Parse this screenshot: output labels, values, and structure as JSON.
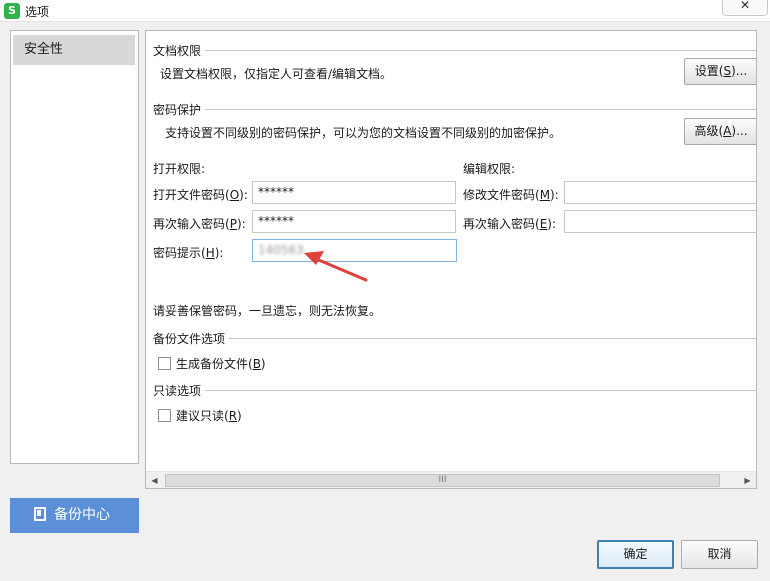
{
  "window": {
    "app_icon": "S",
    "title": "选项",
    "close": "✕"
  },
  "sidebar": {
    "items": [
      {
        "label": "安全性",
        "selected": true
      }
    ],
    "backup_center": "备份中心"
  },
  "doc_permission": {
    "title": "文档权限",
    "desc": "设置文档权限，仅指定人可查看/编辑文档。",
    "button": {
      "pre": "设置(",
      "key": "S",
      "post": ")..."
    }
  },
  "password_protection": {
    "title": "密码保护",
    "desc": "支持设置不同级别的密码保护，可以为您的文档设置不同级别的加密保护。",
    "advanced_button": {
      "pre": "高级(",
      "key": "A",
      "post": ")..."
    },
    "open_permission": {
      "heading": "打开权限:",
      "password": {
        "pre": "打开文件密码(",
        "key": "O",
        "post": "):",
        "value": "******"
      },
      "confirm": {
        "pre": "再次输入密码(",
        "key": "P",
        "post": "):",
        "value": "******"
      },
      "hint": {
        "pre": "密码提示(",
        "key": "H",
        "post": "):",
        "value": "140563"
      }
    },
    "edit_permission": {
      "heading": "编辑权限:",
      "password": {
        "pre": "修改文件密码(",
        "key": "M",
        "post": "):",
        "value": ""
      },
      "confirm": {
        "pre": "再次输入密码(",
        "key": "E",
        "post": "):",
        "value": ""
      }
    },
    "warning": "请妥善保管密码，一旦遗忘，则无法恢复。"
  },
  "backup_options": {
    "title": "备份文件选项",
    "checkbox": {
      "pre": "生成备份文件(",
      "key": "B",
      "post": ")",
      "checked": false
    }
  },
  "readonly_options": {
    "title": "只读选项",
    "checkbox": {
      "pre": "建议只读(",
      "key": "R",
      "post": ")",
      "checked": false
    }
  },
  "scrollbar": {
    "left_arrow": "◀",
    "right_arrow": "▶",
    "grip": "III"
  },
  "dialog_buttons": {
    "ok": "确定",
    "cancel": "取消"
  },
  "colors": {
    "accent": "#5b8fd8",
    "app_icon": "#2fb24c",
    "annotation_arrow": "#e0403a"
  }
}
